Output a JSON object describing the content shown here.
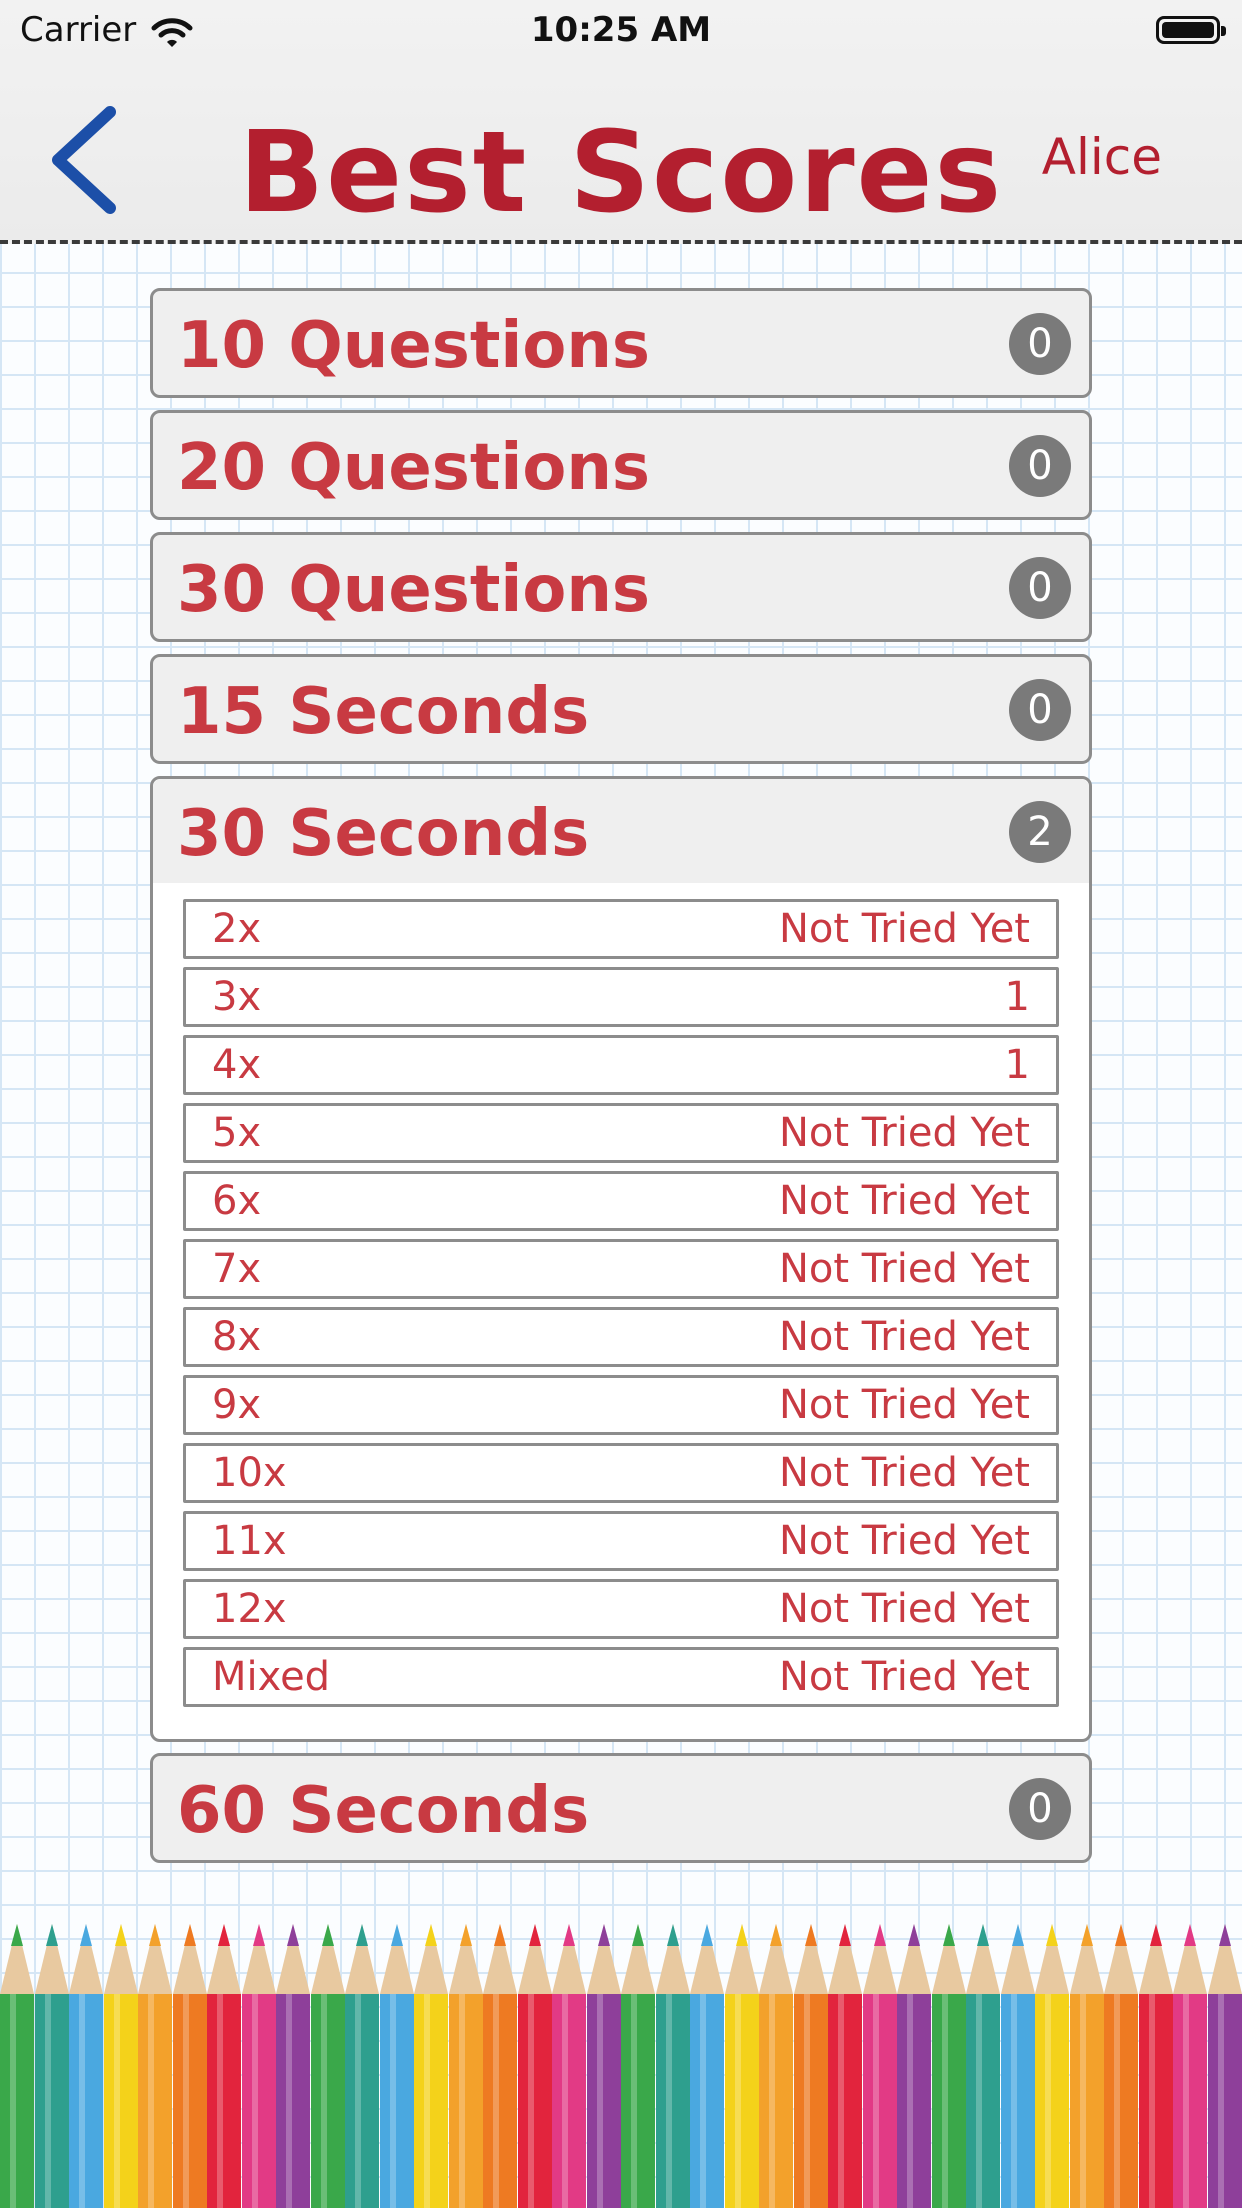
{
  "status_bar": {
    "carrier": "Carrier",
    "time": "10:25 AM"
  },
  "header": {
    "title": "Best Scores",
    "user": "Alice"
  },
  "sections": [
    {
      "label": "10 Questions",
      "count": "0"
    },
    {
      "label": "20 Questions",
      "count": "0"
    },
    {
      "label": "30 Questions",
      "count": "0"
    },
    {
      "label": "15 Seconds",
      "count": "0"
    },
    {
      "label": "30 Seconds",
      "count": "2",
      "rows": [
        {
          "label": "2x",
          "value": "Not Tried Yet"
        },
        {
          "label": "3x",
          "value": "1"
        },
        {
          "label": "4x",
          "value": "1"
        },
        {
          "label": "5x",
          "value": "Not Tried Yet"
        },
        {
          "label": "6x",
          "value": "Not Tried Yet"
        },
        {
          "label": "7x",
          "value": "Not Tried Yet"
        },
        {
          "label": "8x",
          "value": "Not Tried Yet"
        },
        {
          "label": "9x",
          "value": "Not Tried Yet"
        },
        {
          "label": "10x",
          "value": "Not Tried Yet"
        },
        {
          "label": "11x",
          "value": "Not Tried Yet"
        },
        {
          "label": "12x",
          "value": "Not Tried Yet"
        },
        {
          "label": "Mixed",
          "value": "Not Tried Yet"
        }
      ]
    },
    {
      "label": "60 Seconds",
      "count": "0"
    }
  ],
  "colors": {
    "title_red": "#b31f2f",
    "text_red": "#c83a42",
    "badge_gray": "#7a7a7a",
    "back_blue": "#1c4fa8",
    "pencils": [
      "#3aa84a",
      "#2e9f8e",
      "#4aa8e0",
      "#f4d21a",
      "#f3a12b",
      "#ee7a22",
      "#e2243d",
      "#e23a85",
      "#8e3f9a"
    ]
  }
}
